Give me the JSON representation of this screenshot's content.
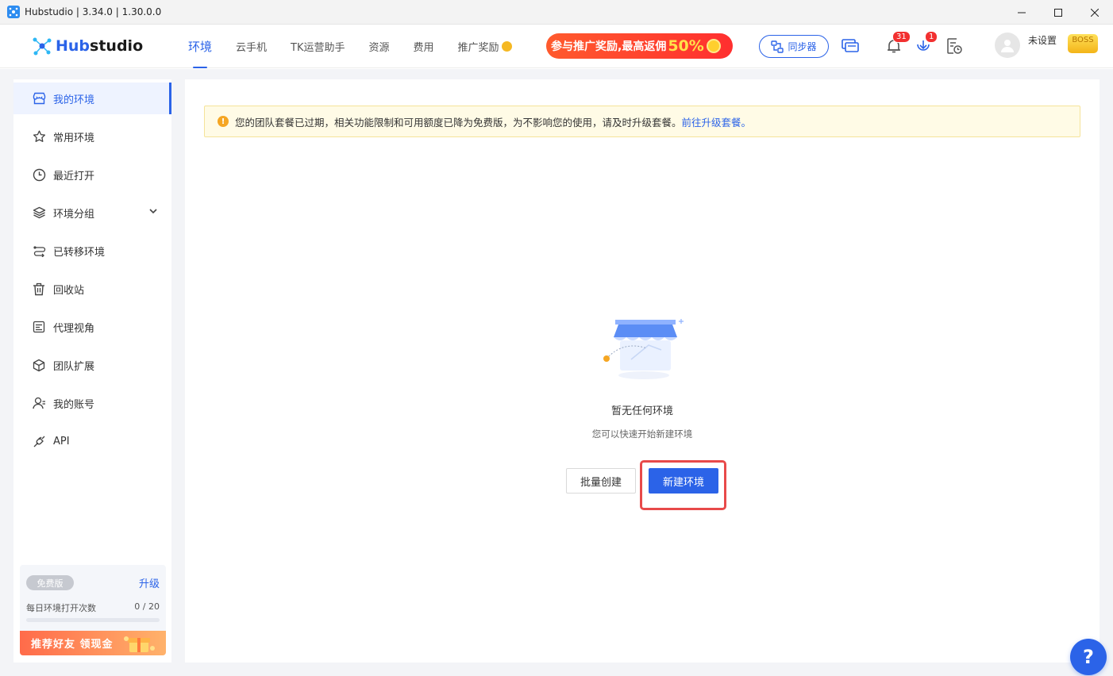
{
  "window": {
    "title": "Hubstudio | 3.34.0 | 1.30.0.0"
  },
  "brand": {
    "logo_prefix": "Hub",
    "logo_suffix": "studio",
    "accent": "#2b63e8"
  },
  "nav": {
    "tabs": [
      {
        "label": "环境",
        "active": true
      },
      {
        "label": "云手机"
      },
      {
        "label": "TK运营助手"
      },
      {
        "label": "资源"
      },
      {
        "label": "费用"
      },
      {
        "label": "推广奖励"
      }
    ],
    "promo_text": "参与推广奖励,最高返佣",
    "promo_pct": "50%",
    "sync_label": "同步器",
    "notifications_badge": "31",
    "downloads_badge": "1",
    "username": "未设置",
    "boss_tag": "BOSS"
  },
  "sidebar": {
    "items": [
      {
        "label": "我的环境",
        "icon": "store-icon",
        "active": true
      },
      {
        "label": "常用环境",
        "icon": "star-icon"
      },
      {
        "label": "最近打开",
        "icon": "clock-icon"
      },
      {
        "label": "环境分组",
        "icon": "layers-icon"
      },
      {
        "label": "已转移环境",
        "icon": "transfer-icon"
      },
      {
        "label": "回收站",
        "icon": "trash-icon"
      },
      {
        "label": "代理视角",
        "icon": "proxy-icon"
      },
      {
        "label": "团队扩展",
        "icon": "cube-icon"
      },
      {
        "label": "我的账号",
        "icon": "user-icon"
      },
      {
        "label": "API",
        "icon": "api-icon"
      }
    ],
    "plan": {
      "tag": "免费版",
      "upgrade": "升级",
      "daily_label": "每日环境打开次数",
      "daily_count": "0 / 20",
      "daily_progress": 0
    },
    "referral": "推荐好友 领现金"
  },
  "main": {
    "notice_text": "您的团队套餐已过期，相关功能限制和可用额度已降为免费版，为不影响您的使用，请及时升级套餐。",
    "notice_link": "前往升级套餐。",
    "empty_title": "暂无任何环境",
    "empty_sub": "您可以快速开始新建环境",
    "batch_create": "批量创建",
    "new_env": "新建环境",
    "help": "?"
  }
}
